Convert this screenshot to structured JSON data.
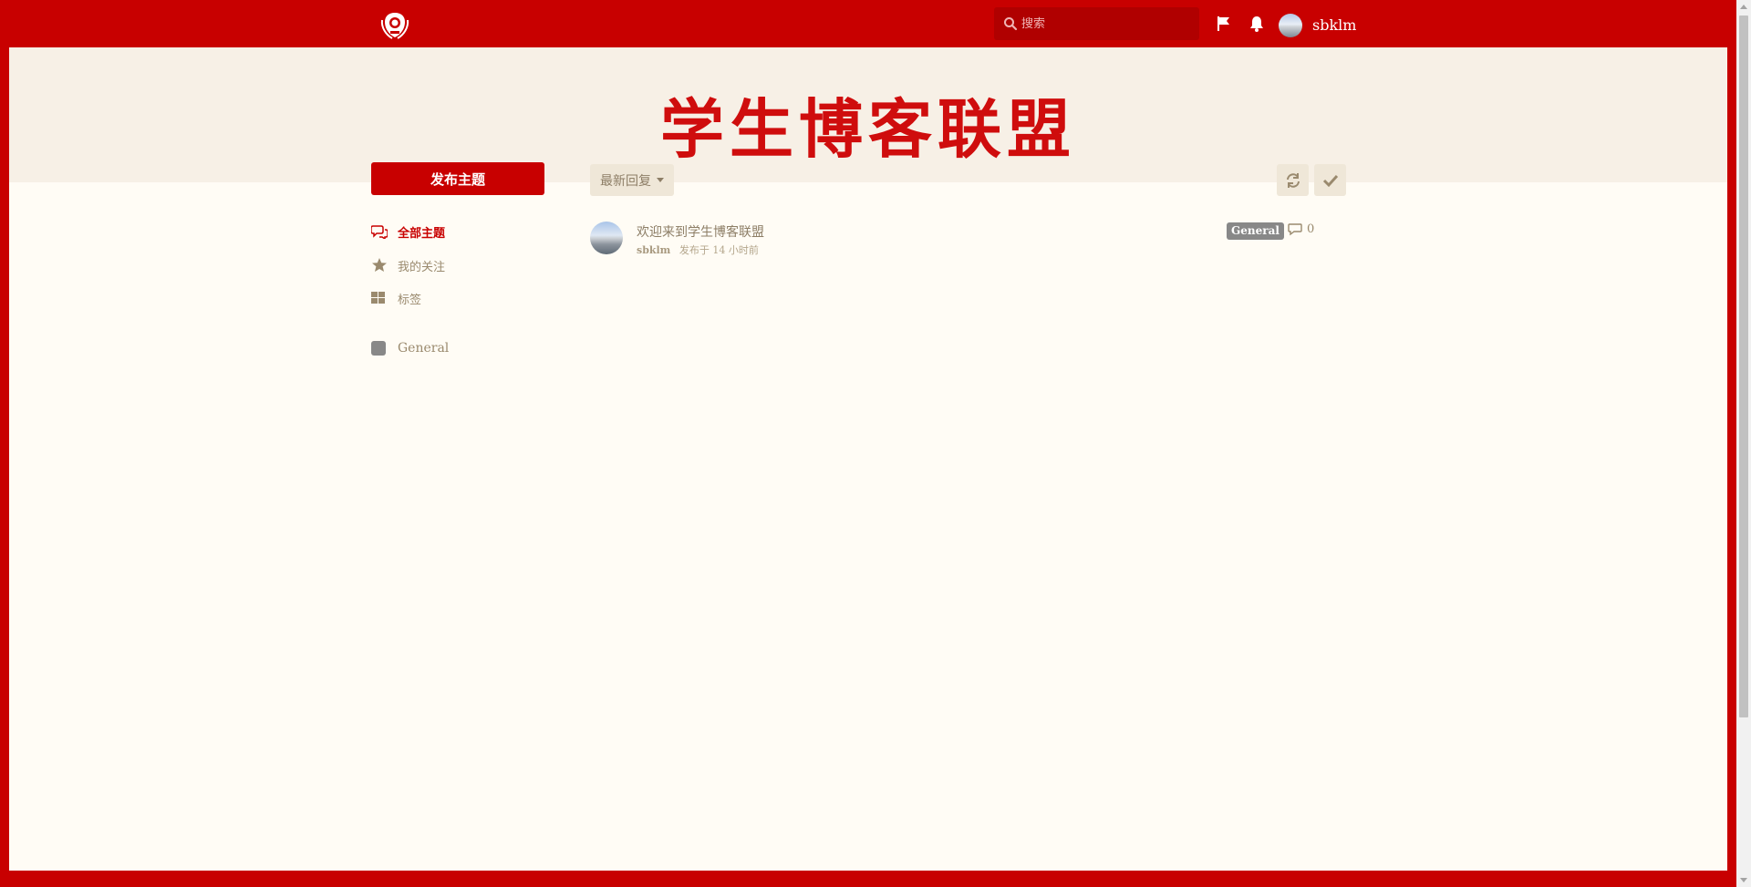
{
  "header": {
    "search_placeholder": "搜索",
    "username": "sbklm"
  },
  "hero": {
    "title": "学生博客联盟"
  },
  "sidebar": {
    "new_topic_label": "发布主题",
    "nav": [
      {
        "label": "全部主题",
        "icon": "comments-icon",
        "active": true
      },
      {
        "label": "我的关注",
        "icon": "star-icon",
        "active": false
      },
      {
        "label": "标签",
        "icon": "grid-icon",
        "active": false
      }
    ],
    "tags": [
      {
        "label": "General",
        "color": "#888888"
      }
    ]
  },
  "toolbar": {
    "sort_label": "最新回复",
    "refresh_icon": "refresh-icon",
    "mark_read_icon": "check-icon"
  },
  "discussions": [
    {
      "title": "欢迎来到学生博客联盟",
      "author": "sbklm",
      "meta": "发布于 14 小时前",
      "tag": "General",
      "replies": "0"
    }
  ],
  "colors": {
    "brand": "#c80000",
    "hero_bg": "#f7f0e6",
    "body_bg": "#fffcf5",
    "muted_text": "#8d7e66",
    "tag_gray": "#888888"
  }
}
